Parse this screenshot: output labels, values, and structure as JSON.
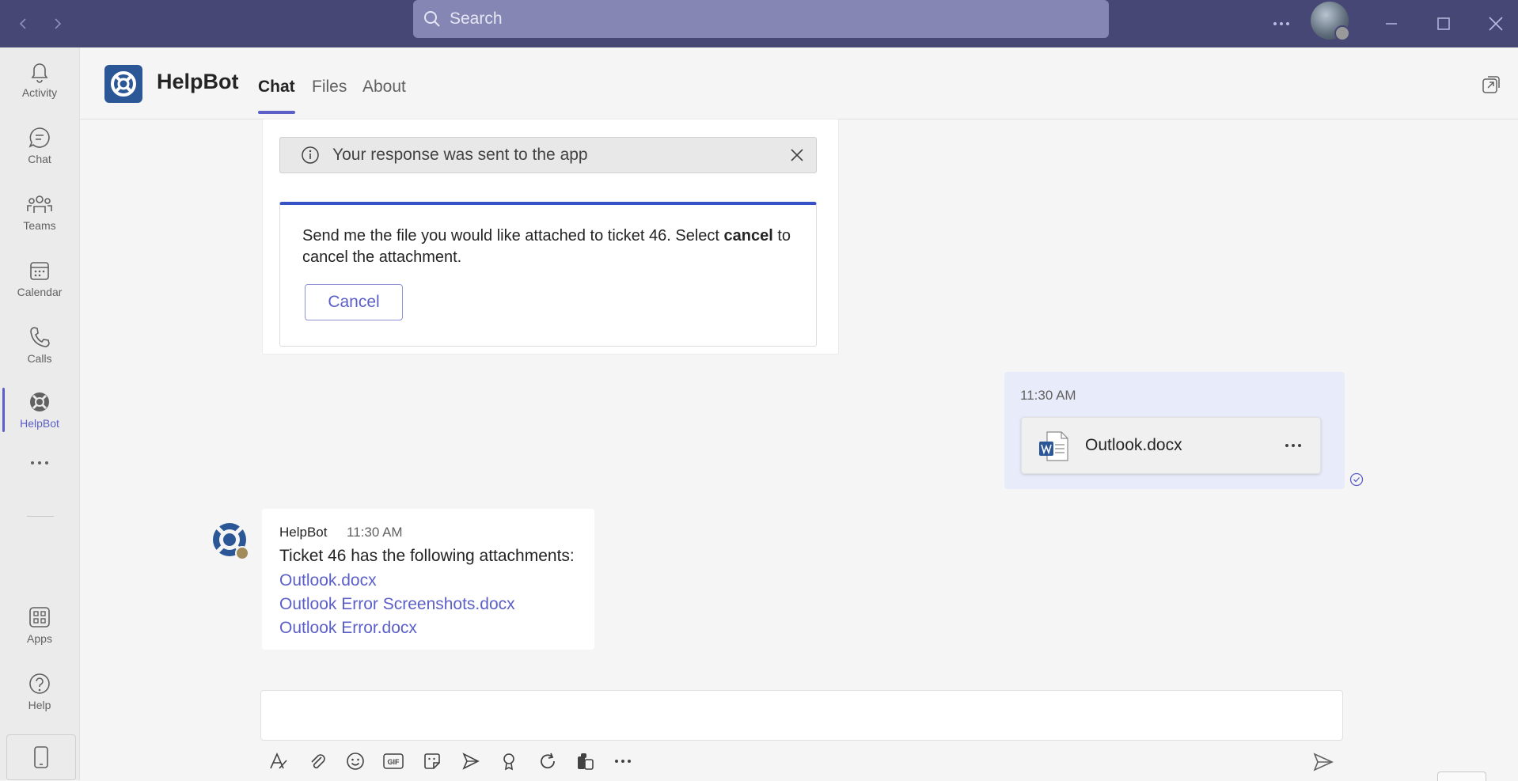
{
  "titlebar": {
    "search_placeholder": "Search",
    "colors": {
      "bar": "#464775",
      "search": "#8586b4"
    }
  },
  "rail": {
    "items": [
      {
        "label": "Activity",
        "icon": "bell-icon"
      },
      {
        "label": "Chat",
        "icon": "chat-icon"
      },
      {
        "label": "Teams",
        "icon": "teams-icon"
      },
      {
        "label": "Calendar",
        "icon": "calendar-icon"
      },
      {
        "label": "Calls",
        "icon": "phone-icon"
      },
      {
        "label": "HelpBot",
        "icon": "lifebuoy-icon",
        "active": true
      },
      {
        "label": "Apps",
        "icon": "apps-icon"
      },
      {
        "label": "Help",
        "icon": "help-icon"
      }
    ]
  },
  "header": {
    "app_name": "HelpBot",
    "tabs": [
      {
        "label": "Chat",
        "active": true
      },
      {
        "label": "Files"
      },
      {
        "label": "About"
      }
    ],
    "accent": "#5b5fc7"
  },
  "chat": {
    "notice_text": "Your response was sent to the app",
    "card": {
      "text_before": "Send me the file you would like attached to ticket 46. Select ",
      "text_bold": "cancel",
      "text_after": " to cancel the attachment.",
      "cancel_label": "Cancel"
    },
    "my_message": {
      "time": "11:30 AM",
      "file_name": "Outlook.docx"
    },
    "bot_reply": {
      "name": "HelpBot",
      "time": "11:30 AM",
      "text": "Ticket 46 has the following attachments:",
      "links": [
        "Outlook.docx",
        "Outlook Error Screenshots.docx",
        "Outlook Error.docx"
      ]
    }
  },
  "compose": {
    "tools": [
      "format-icon",
      "attach-icon",
      "emoji-icon",
      "gif-icon",
      "sticker-icon",
      "meet-icon",
      "praise-icon",
      "loop-icon",
      "apps-icon",
      "more-icon"
    ]
  }
}
